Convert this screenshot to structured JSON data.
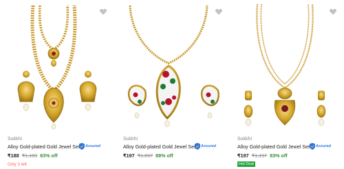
{
  "colors": {
    "price": "#212121",
    "mrp": "#878787",
    "discount": "#388e3c",
    "stock_warning": "#ff6161",
    "hot_deal_bg": "#26a541",
    "assured_blue": "#2874f0",
    "wishlist_heart": "#c2c2c2",
    "gold": "#d4a62a"
  },
  "products": [
    {
      "brand": "Sukkhi",
      "title": "Alloy Gold-plated Gold Jewel Set",
      "assured_label": "Assured",
      "price": "₹188",
      "mrp": "₹1,183",
      "discount": "83% off",
      "stock_note": "Only 3 left",
      "wishlist_icon": "heart-icon"
    },
    {
      "brand": "Sukkhi",
      "title": "Alloy Gold-plated Gold Jewel Set",
      "assured_label": "Assured",
      "price": "₹197",
      "mrp": "₹1,697",
      "discount": "88% off",
      "wishlist_icon": "heart-icon"
    },
    {
      "brand": "Sukkhi",
      "title": "Alloy Gold-plated Gold Jewel Set",
      "assured_label": "Assured",
      "price": "₹197",
      "mrp": "₹1,197",
      "discount": "83% off",
      "badge": "Hot Deal",
      "wishlist_icon": "heart-icon"
    }
  ]
}
